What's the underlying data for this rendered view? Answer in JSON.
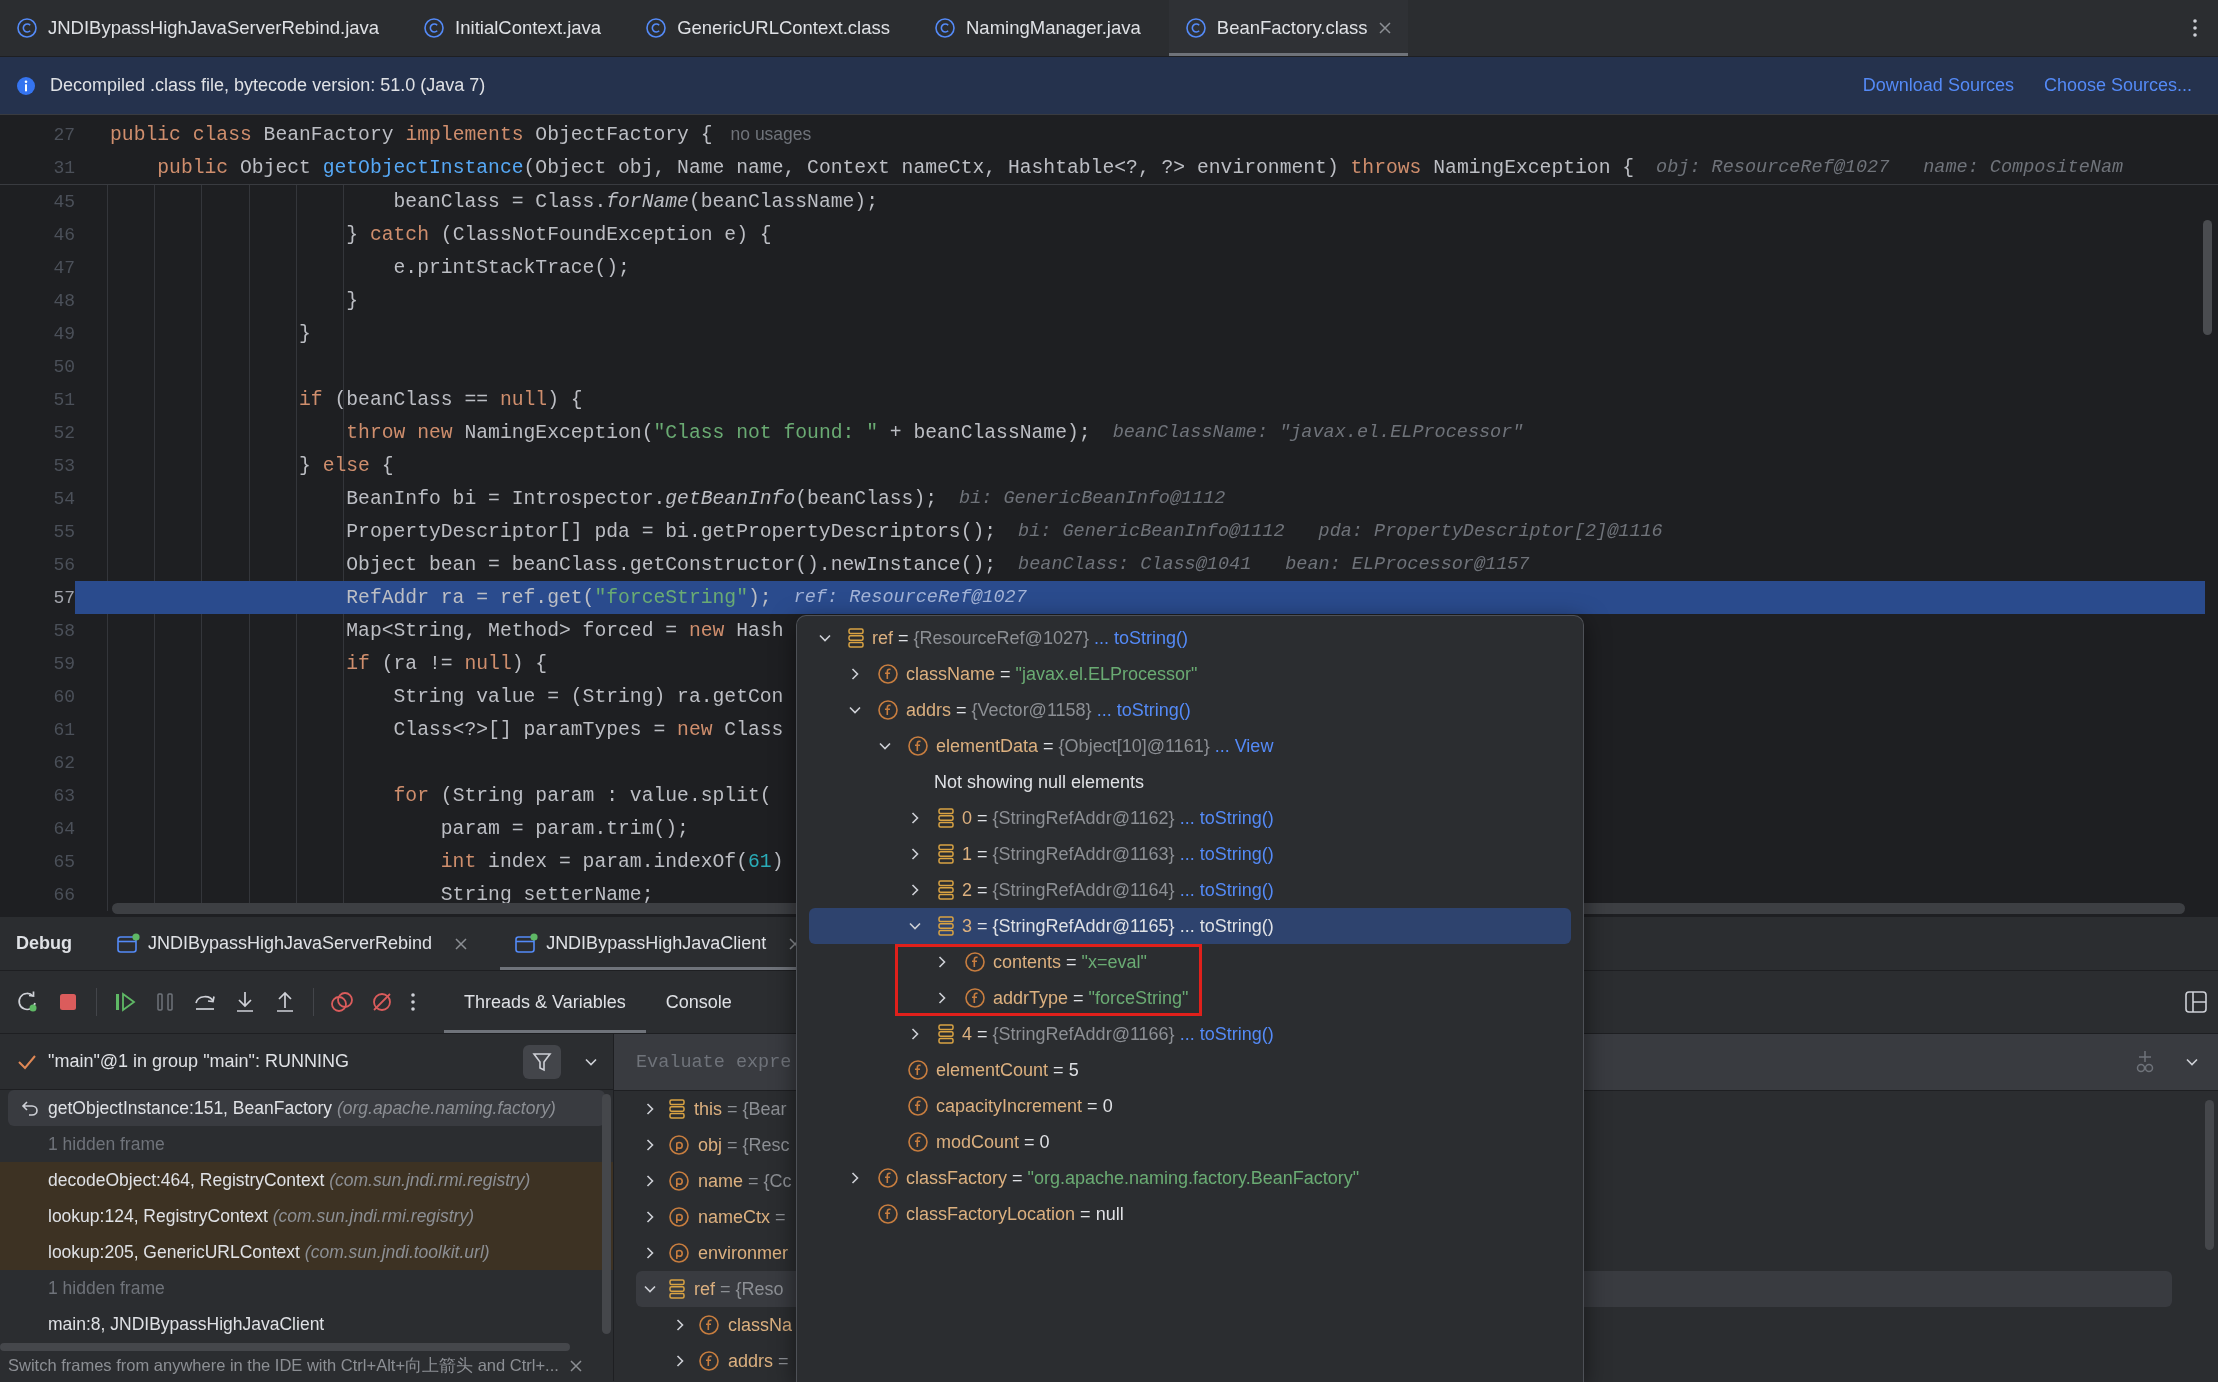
{
  "editor_tabs": [
    {
      "label": "JNDIBypassHighJavaServerRebind.java",
      "selected": false
    },
    {
      "label": "InitialContext.java",
      "selected": false
    },
    {
      "label": "GenericURLContext.class",
      "selected": false
    },
    {
      "label": "NamingManager.java",
      "selected": false
    },
    {
      "label": "BeanFactory.class",
      "selected": true
    }
  ],
  "banner": {
    "text": "Decompiled .class file, bytecode version: 51.0 (Java 7)",
    "links": [
      "Download Sources",
      "Choose Sources..."
    ]
  },
  "sticky_lines": [
    {
      "number": "27",
      "code": [
        {
          "kind": "kw",
          "t": "public"
        },
        {
          "kind": "kw",
          "t": " class"
        },
        {
          "kind": "plain",
          "t": " BeanFactory "
        },
        {
          "kind": "kw",
          "t": "implements"
        },
        {
          "kind": "plain",
          "t": " ObjectFactory {"
        }
      ],
      "usage": "no usages"
    },
    {
      "number": "31",
      "code": [
        {
          "kind": "kw",
          "t": "    public"
        },
        {
          "kind": "plain",
          "t": " Object "
        },
        {
          "kind": "fn",
          "t": "getObjectInstance"
        },
        {
          "kind": "plain",
          "t": "(Object obj, Name name, Context nameCtx, Hashtable<?, ?> environment) "
        },
        {
          "kind": "kw",
          "t": "throws"
        },
        {
          "kind": "plain",
          "t": " NamingException {"
        }
      ],
      "hints": [
        "obj: ResourceRef@1027",
        "name: CompositeNam"
      ]
    }
  ],
  "code_lines": [
    {
      "number": "45",
      "current": false,
      "code": [
        {
          "kind": "plain",
          "t": "                        beanClass = Class."
        },
        {
          "kind": "call",
          "t": "forName"
        },
        {
          "kind": "plain",
          "t": "(beanClassName);"
        }
      ]
    },
    {
      "number": "46",
      "current": false,
      "code": [
        {
          "kind": "plain",
          "t": "                    } "
        },
        {
          "kind": "kw",
          "t": "catch"
        },
        {
          "kind": "plain",
          "t": " (ClassNotFoundException e) {"
        }
      ]
    },
    {
      "number": "47",
      "current": false,
      "code": [
        {
          "kind": "plain",
          "t": "                        e.printStackTrace();"
        }
      ]
    },
    {
      "number": "48",
      "current": false,
      "code": [
        {
          "kind": "plain",
          "t": "                    }"
        }
      ]
    },
    {
      "number": "49",
      "current": false,
      "code": [
        {
          "kind": "plain",
          "t": "                }"
        }
      ]
    },
    {
      "number": "50",
      "current": false
    },
    {
      "number": "51",
      "current": false,
      "code": [
        {
          "kind": "kw",
          "t": "                if"
        },
        {
          "kind": "plain",
          "t": " (beanClass == "
        },
        {
          "kind": "kw",
          "t": "null"
        },
        {
          "kind": "plain",
          "t": ") {"
        }
      ]
    },
    {
      "number": "52",
      "current": false,
      "code": [
        {
          "kind": "kw",
          "t": "                    throw new"
        },
        {
          "kind": "plain",
          "t": " NamingException("
        },
        {
          "kind": "str",
          "t": "\"Class not found: \""
        },
        {
          "kind": "plain",
          "t": " + beanClassName);"
        }
      ],
      "hints": [
        "beanClassName: \"javax.el.ELProcessor\""
      ]
    },
    {
      "number": "53",
      "current": false,
      "code": [
        {
          "kind": "plain",
          "t": "                } "
        },
        {
          "kind": "kw",
          "t": "else"
        },
        {
          "kind": "plain",
          "t": " {"
        }
      ]
    },
    {
      "number": "54",
      "current": false,
      "code": [
        {
          "kind": "plain",
          "t": "                    BeanInfo bi = Introspector."
        },
        {
          "kind": "call",
          "t": "getBeanInfo"
        },
        {
          "kind": "plain",
          "t": "(beanClass);"
        }
      ],
      "hints": [
        "bi: GenericBeanInfo@1112"
      ]
    },
    {
      "number": "55",
      "current": false,
      "code": [
        {
          "kind": "plain",
          "t": "                    PropertyDescriptor[] pda = bi.getPropertyDescriptors();"
        }
      ],
      "hints": [
        "bi: GenericBeanInfo@1112",
        "pda: PropertyDescriptor[2]@1116"
      ]
    },
    {
      "number": "56",
      "current": false,
      "code": [
        {
          "kind": "plain",
          "t": "                    Object bean = beanClass.getConstructor().newInstance();"
        }
      ],
      "hints": [
        "beanClass: Class@1041",
        "bean: ELProcessor@1157"
      ]
    },
    {
      "number": "57",
      "current": true,
      "code": [
        {
          "kind": "plain",
          "t": "                    RefAddr ra = ref.get("
        },
        {
          "kind": "str",
          "t": "\"forceString\""
        },
        {
          "kind": "plain",
          "t": ");"
        }
      ],
      "hints": [
        "ref: ResourceRef@1027"
      ]
    },
    {
      "number": "58",
      "current": false,
      "code": [
        {
          "kind": "plain",
          "t": "                    Map<String, Method> forced = "
        },
        {
          "kind": "kw",
          "t": "new"
        },
        {
          "kind": "plain",
          "t": " Hash"
        }
      ]
    },
    {
      "number": "59",
      "current": false,
      "code": [
        {
          "kind": "kw",
          "t": "                    if"
        },
        {
          "kind": "plain",
          "t": " (ra != "
        },
        {
          "kind": "kw",
          "t": "null"
        },
        {
          "kind": "plain",
          "t": ") {"
        }
      ]
    },
    {
      "number": "60",
      "current": false,
      "code": [
        {
          "kind": "plain",
          "t": "                        String value = (String) ra.getCon"
        }
      ]
    },
    {
      "number": "61",
      "current": false,
      "code": [
        {
          "kind": "plain",
          "t": "                        Class<?>[] paramTypes = "
        },
        {
          "kind": "kw",
          "t": "new"
        },
        {
          "kind": "plain",
          "t": " Class"
        }
      ]
    },
    {
      "number": "62",
      "current": false
    },
    {
      "number": "63",
      "current": false,
      "code": [
        {
          "kind": "kw",
          "t": "                        for"
        },
        {
          "kind": "plain",
          "t": " (String param : value.split("
        }
      ]
    },
    {
      "number": "64",
      "current": false,
      "code": [
        {
          "kind": "plain",
          "t": "                            param = param.trim();"
        }
      ]
    },
    {
      "number": "65",
      "current": false,
      "code": [
        {
          "kind": "kw",
          "t": "                            int"
        },
        {
          "kind": "plain",
          "t": " index = param.indexOf("
        },
        {
          "kind": "num",
          "t": "61"
        },
        {
          "kind": "plain",
          "t": ")"
        }
      ]
    },
    {
      "number": "66",
      "current": false,
      "code": [
        {
          "kind": "plain",
          "t": "                            String setterName;"
        }
      ]
    }
  ],
  "debug": {
    "title": "Debug",
    "sessions": [
      {
        "label": "JNDIBypassHighJavaServerRebind",
        "selected": false
      },
      {
        "label": "JNDIBypassHighJavaClient",
        "selected": true
      }
    ],
    "panel_tabs": [
      {
        "label": "Threads & Variables",
        "selected": true
      },
      {
        "label": "Console",
        "selected": false
      }
    ],
    "thread": "\"main\"@1 in group \"main\": RUNNING",
    "frames": [
      {
        "kind": "frame",
        "method": "getObjectInstance:151, BeanFactory",
        "package": "(org.apache.naming.factory)",
        "selected": true,
        "library": false
      },
      {
        "kind": "hidden",
        "text": "1 hidden frame"
      },
      {
        "kind": "frame",
        "method": "decodeObject:464, RegistryContext",
        "package": "(com.sun.jndi.rmi.registry)",
        "selected": false,
        "library": true
      },
      {
        "kind": "frame",
        "method": "lookup:124, RegistryContext",
        "package": "(com.sun.jndi.rmi.registry)",
        "selected": false,
        "library": true
      },
      {
        "kind": "frame",
        "method": "lookup:205, GenericURLContext",
        "package": "(com.sun.jndi.toolkit.url)",
        "selected": false,
        "library": true
      },
      {
        "kind": "hidden",
        "text": "1 hidden frame"
      },
      {
        "kind": "frame",
        "method": "main:8, JNDIBypassHighJavaClient",
        "selected": false,
        "library": false
      }
    ],
    "evaluate_placeholder": "Evaluate expre",
    "variables": [
      {
        "kind": "object",
        "name": "this",
        "rest": "= {Bear",
        "expanded": false,
        "selected": false
      },
      {
        "kind": "param",
        "name": "obj",
        "rest": "= {Resc",
        "expanded": false,
        "selected": false
      },
      {
        "kind": "param",
        "name": "name",
        "rest": "= {Cc",
        "expanded": false,
        "selected": false
      },
      {
        "kind": "param",
        "name": "nameCtx",
        "rest": "=",
        "expanded": false,
        "selected": false
      },
      {
        "kind": "param",
        "name": "environmer",
        "expanded": false,
        "selected": false
      },
      {
        "kind": "object",
        "name": "ref",
        "rest": "= {Reso",
        "expanded": true,
        "selected": true,
        "children": [
          {
            "kind": "field",
            "name": "classNa",
            "expanded": false,
            "selected": false
          },
          {
            "kind": "field",
            "name": "addrs",
            "rest": "=",
            "expanded": false,
            "selected": false
          }
        ]
      }
    ],
    "hint": "Switch frames from anywhere in the IDE with Ctrl+Alt+向上箭头 and Ctrl+..."
  },
  "popup": {
    "tree": [
      {
        "kind": "object",
        "name": "ref",
        "sign": "=",
        "value": {
          "kind": "object",
          "text": "{ResourceRef@1027}"
        },
        "link": "... toString()",
        "expanded": true,
        "selected": false,
        "children": [
          {
            "kind": "field",
            "name": "className",
            "sign": "=",
            "value": {
              "kind": "string",
              "text": "\"javax.el.ELProcessor\""
            },
            "expanded": false,
            "selected": false
          },
          {
            "kind": "field",
            "name": "addrs",
            "sign": "=",
            "value": {
              "kind": "object",
              "text": "{Vector@1158}"
            },
            "link": "... toString()",
            "expanded": true,
            "selected": false,
            "children": [
              {
                "kind": "field",
                "name": "elementData",
                "sign": "=",
                "value": {
                  "kind": "object",
                  "text": "{Object[10]@1161}"
                },
                "link": "... View",
                "expanded": true,
                "selected": false,
                "children": [
                  {
                    "kind": "note",
                    "text": "Not showing null elements"
                  },
                  {
                    "kind": "object",
                    "name": "0",
                    "sign": "=",
                    "value": {
                      "kind": "object",
                      "text": "{StringRefAddr@1162}"
                    },
                    "link": "... toString()",
                    "expanded": false,
                    "selected": false
                  },
                  {
                    "kind": "object",
                    "name": "1",
                    "sign": "=",
                    "value": {
                      "kind": "object",
                      "text": "{StringRefAddr@1163}"
                    },
                    "link": "... toString()",
                    "expanded": false,
                    "selected": false
                  },
                  {
                    "kind": "object",
                    "name": "2",
                    "sign": "=",
                    "value": {
                      "kind": "object",
                      "text": "{StringRefAddr@1164}"
                    },
                    "link": "... toString()",
                    "expanded": false,
                    "selected": false
                  },
                  {
                    "kind": "object",
                    "name": "3",
                    "sign": "=",
                    "value": {
                      "kind": "object",
                      "text": "{StringRefAddr@1165}"
                    },
                    "link": "... toString()",
                    "expanded": true,
                    "selected": true,
                    "boxed": true,
                    "children": [
                      {
                        "kind": "field",
                        "name": "contents",
                        "sign": "=",
                        "value": {
                          "kind": "string",
                          "text": "\"x=eval\""
                        },
                        "expanded": false,
                        "selected": false
                      },
                      {
                        "kind": "field",
                        "name": "addrType",
                        "sign": "=",
                        "value": {
                          "kind": "string",
                          "text": "\"forceString\""
                        },
                        "expanded": false,
                        "selected": false
                      }
                    ]
                  },
                  {
                    "kind": "object",
                    "name": "4",
                    "sign": "=",
                    "value": {
                      "kind": "object",
                      "text": "{StringRefAddr@1166}"
                    },
                    "link": "... toString()",
                    "expanded": false,
                    "selected": false
                  }
                ]
              },
              {
                "kind": "field",
                "name": "elementCount",
                "sign": "=",
                "value": {
                  "kind": "plain",
                  "text": "5"
                },
                "selected": false
              },
              {
                "kind": "field",
                "name": "capacityIncrement",
                "sign": "=",
                "value": {
                  "kind": "plain",
                  "text": "0"
                },
                "selected": false
              },
              {
                "kind": "field",
                "name": "modCount",
                "sign": "=",
                "value": {
                  "kind": "plain",
                  "text": "0"
                },
                "selected": false
              }
            ]
          },
          {
            "kind": "field",
            "name": "classFactory",
            "sign": "=",
            "value": {
              "kind": "string",
              "text": "\"org.apache.naming.factory.BeanFactory\""
            },
            "expanded": false,
            "selected": false
          },
          {
            "kind": "field",
            "name": "classFactoryLocation",
            "sign": "=",
            "value": {
              "kind": "plain",
              "text": "null"
            },
            "selected": false
          }
        ]
      }
    ]
  }
}
